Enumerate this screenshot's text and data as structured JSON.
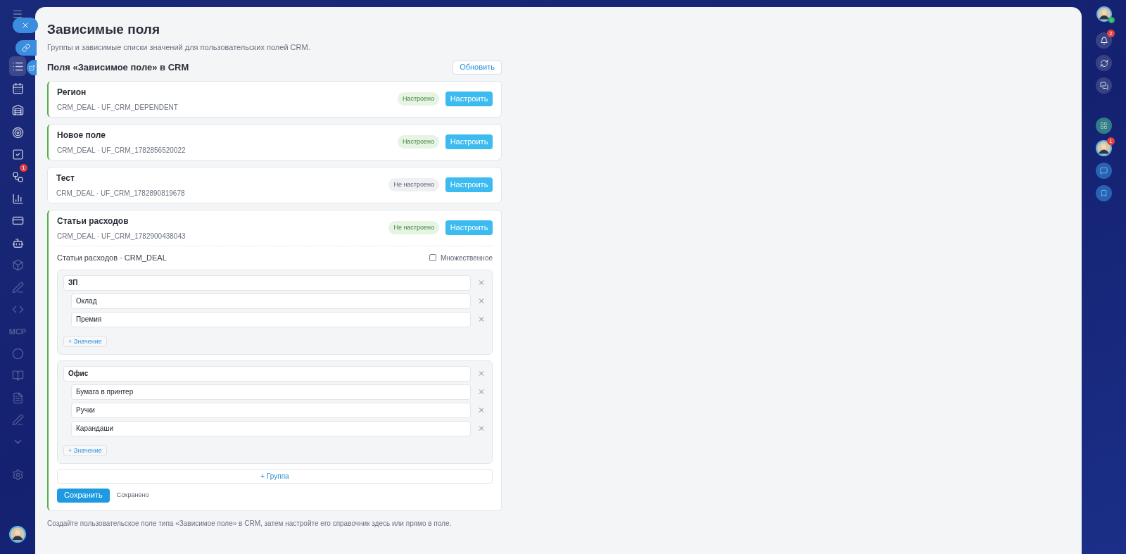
{
  "left_sidebar": {
    "automation_badge": "1",
    "mcp_label": "MCP"
  },
  "right_sidebar": {
    "notifications_badge": "2",
    "contact_badge": "1"
  },
  "page": {
    "title": "Зависимые поля",
    "subtitle": "Группы и зависимые списки значений для пользовательских полей CRM."
  },
  "section": {
    "title": "Поля «Зависимое поле» в CRM",
    "refresh_button": "Обновить"
  },
  "fields": [
    {
      "name": "Регион",
      "code": "CRM_DEAL · UF_CRM_DEPENDENT",
      "accent": true,
      "status": "Настроено",
      "color": "#e6f4e4",
      "configure_button": "Настроить",
      "expanded": false
    },
    {
      "name": "Новое поле",
      "code": "CRM_DEAL · UF_CRM_1782856520022",
      "accent": true,
      "status": "Настроено",
      "color": "#e6f4e4",
      "configure_button": "Настроить",
      "expanded": false
    },
    {
      "name": "Тест",
      "code": "CRM_DEAL · UF_CRM_1782890819678",
      "accent": false,
      "status": "Не настроено",
      "color": "#eef0f3",
      "configure_button": "Настроить",
      "expanded": false
    },
    {
      "name": "Статьи расходов",
      "code": "CRM_DEAL · UF_CRM_1782900438043",
      "accent": true,
      "status": "Не настроено",
      "color": "#e6f4e4",
      "configure_button": "Настроить",
      "expanded": true
    }
  ],
  "editor": {
    "title": "Статьи расходов · CRM_DEAL",
    "multiple": {
      "label": "Множественное",
      "checked": false
    },
    "groups": [
      {
        "name": "ЗП",
        "values": [
          "Оклад",
          "Премия"
        ],
        "add_value": "+ Значение"
      },
      {
        "name": "Офис",
        "values": [
          "Бумага в принтер",
          "Ручки",
          "Карандаши"
        ],
        "add_value": "+ Значение"
      }
    ],
    "add_group": "+ Группа",
    "save_button": "Сохранить",
    "save_status": "Сохранено"
  },
  "footer_note": "Создайте пользовательское поле типа «Зависимое поле» в CRM, затем настройте его справочник здесь или прямо в поле."
}
